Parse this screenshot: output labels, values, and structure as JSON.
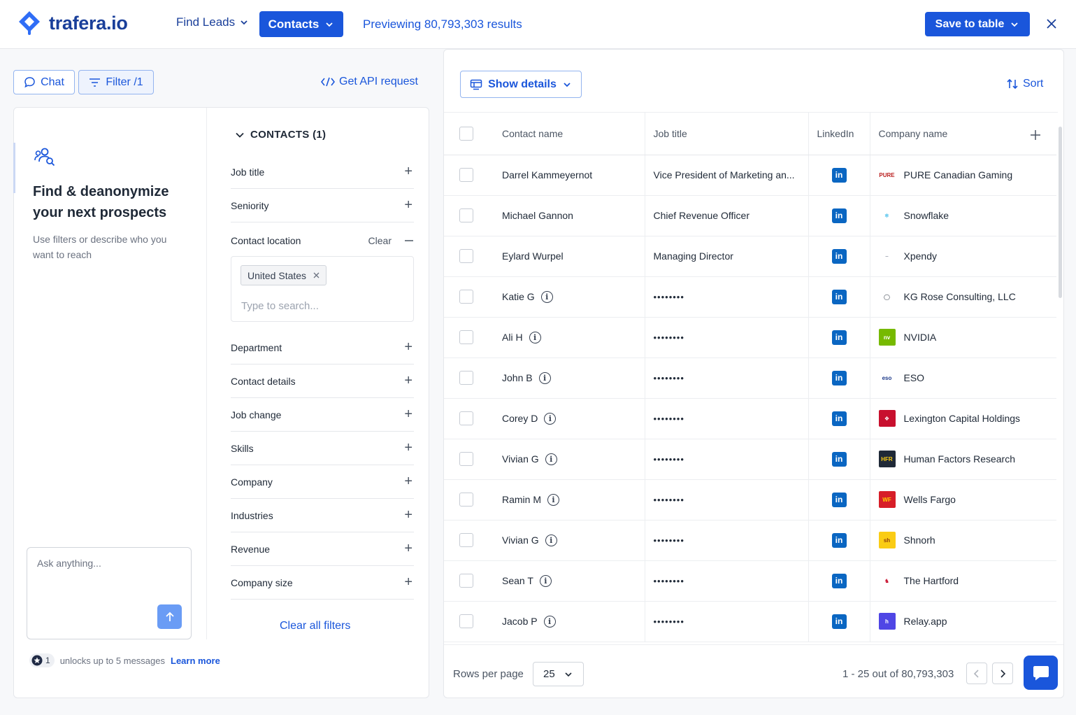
{
  "header": {
    "brand": "trafera.io",
    "nav_find_leads": "Find Leads",
    "nav_contacts": "Contacts",
    "preview": "Previewing 80,793,303 results",
    "save_to_table": "Save to table"
  },
  "toolbar": {
    "chat": "Chat",
    "filter": "Filter /1",
    "api": "Get API request"
  },
  "chat": {
    "title": "Find & deanonymize your next prospects",
    "subtitle": "Use filters or describe who you want to reach",
    "placeholder": "Ask anything...",
    "credit_count": "1",
    "credit_text": "unlocks up to 5 messages",
    "learn_more": "Learn more"
  },
  "filters": {
    "heading": "CONTACTS (1)",
    "job_title": "Job title",
    "seniority": "Seniority",
    "contact_location": "Contact location",
    "clear": "Clear",
    "location_chip": "United States",
    "location_placeholder": "Type to search...",
    "items": [
      "Department",
      "Contact details",
      "Job change",
      "Skills",
      "Company",
      "Industries",
      "Revenue",
      "Company size"
    ],
    "clear_all": "Clear all filters"
  },
  "results": {
    "show_details": "Show details",
    "sort": "Sort",
    "columns": [
      "Contact name",
      "Job title",
      "LinkedIn",
      "Company name"
    ],
    "rows": [
      {
        "name": "Darrel Kammeyernot",
        "info": false,
        "title": "Vice President of Marketing an...",
        "company": "PURE Canadian Gaming",
        "logo": "PURE",
        "logo_bg": "#ffffff",
        "logo_fg": "#b91c1c"
      },
      {
        "name": "Michael Gannon",
        "info": false,
        "title": "Chief Revenue Officer",
        "company": "Snowflake",
        "logo": "❄",
        "logo_bg": "#ffffff",
        "logo_fg": "#29b5e8"
      },
      {
        "name": "Eylard Wurpel",
        "info": false,
        "title": "Managing Director",
        "company": "Xpendy",
        "logo": "–",
        "logo_bg": "#ffffff",
        "logo_fg": "#9ca3af"
      },
      {
        "name": "Katie G",
        "info": true,
        "title": "••••••••",
        "company": "KG Rose Consulting, LLC",
        "logo": "◯",
        "logo_bg": "#ffffff",
        "logo_fg": "#1f2937"
      },
      {
        "name": "Ali H",
        "info": true,
        "title": "••••••••",
        "company": "NVIDIA",
        "logo": "nv",
        "logo_bg": "#76b900",
        "logo_fg": "#ffffff"
      },
      {
        "name": "John B",
        "info": true,
        "title": "••••••••",
        "company": "ESO",
        "logo": "eso",
        "logo_bg": "#ffffff",
        "logo_fg": "#1e3a8a"
      },
      {
        "name": "Corey D",
        "info": true,
        "title": "••••••••",
        "company": "Lexington Capital Holdings",
        "logo": "❖",
        "logo_bg": "#c8102e",
        "logo_fg": "#ffffff"
      },
      {
        "name": "Vivian G",
        "info": true,
        "title": "••••••••",
        "company": "Human Factors Research",
        "logo": "HFR",
        "logo_bg": "#1f2937",
        "logo_fg": "#facc15"
      },
      {
        "name": "Ramin M",
        "info": true,
        "title": "••••••••",
        "company": "Wells Fargo",
        "logo": "WF",
        "logo_bg": "#d71e28",
        "logo_fg": "#ffd200"
      },
      {
        "name": "Vivian G",
        "info": true,
        "title": "••••••••",
        "company": "Shnorh",
        "logo": "sh",
        "logo_bg": "#facc15",
        "logo_fg": "#92400e"
      },
      {
        "name": "Sean T",
        "info": true,
        "title": "••••••••",
        "company": "The Hartford",
        "logo": "♞",
        "logo_bg": "#ffffff",
        "logo_fg": "#c8102e"
      },
      {
        "name": "Jacob P",
        "info": true,
        "title": "••••••••",
        "company": "Relay.app",
        "logo": "h",
        "logo_bg": "#4f46e5",
        "logo_fg": "#ffffff"
      }
    ],
    "linkedin_glyph": "in",
    "rows_per_page_label": "Rows per page",
    "rows_per_page": "25",
    "range": "1 - 25 out of 80,793,303"
  },
  "icons": [
    "logo-icon",
    "chevron-down-icon",
    "close-icon",
    "chat-bubble-icon",
    "filter-lines-icon",
    "code-icon",
    "people-search-icon",
    "arrow-up-icon",
    "star-badge-icon",
    "plus-icon",
    "minus-icon",
    "table-details-icon",
    "sort-arrows-icon",
    "info-icon",
    "linkedin-icon",
    "chevron-left-icon",
    "chevron-right-icon",
    "message-icon"
  ],
  "colors": {
    "accent": "#1a56db",
    "brand_text": "#1a3f9a",
    "linkedin": "#0a66c2"
  }
}
